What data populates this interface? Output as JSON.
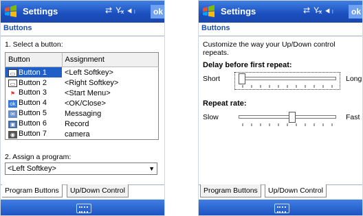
{
  "left": {
    "app_title": "Settings",
    "ok_label": "ok",
    "heading": "Buttons",
    "select_prompt": "1. Select a button:",
    "columns": [
      "Button",
      "Assignment"
    ],
    "rows": [
      {
        "button": "Button 1",
        "assignment": "<Left Softkey>",
        "icon": "softkey-left-icon"
      },
      {
        "button": "Button 2",
        "assignment": "<Right Softkey>",
        "icon": "softkey-right-icon"
      },
      {
        "button": "Button 3",
        "assignment": "<Start Menu>",
        "icon": "start-flag-icon"
      },
      {
        "button": "Button 4",
        "assignment": "<OK/Close>",
        "icon": "ok-icon"
      },
      {
        "button": "Button 5",
        "assignment": "Messaging",
        "icon": "messaging-icon"
      },
      {
        "button": "Button 6",
        "assignment": "Record",
        "icon": "record-icon"
      },
      {
        "button": "Button 7",
        "assignment": "camera",
        "icon": "camera-icon"
      }
    ],
    "selected_row": 0,
    "assign_prompt": "2. Assign a program:",
    "program_value": "<Left Softkey>",
    "tabs": [
      "Program Buttons",
      "Up/Down Control"
    ],
    "active_tab": 0
  },
  "right": {
    "app_title": "Settings",
    "ok_label": "ok",
    "heading": "Buttons",
    "description": "Customize the way your Up/Down control repeats.",
    "delay_label": "Delay before first repeat:",
    "delay_min": "Short",
    "delay_max": "Long",
    "delay_level": 0.0,
    "rate_label": "Repeat rate:",
    "rate_min": "Slow",
    "rate_max": "Fast",
    "rate_level": 0.55,
    "tabs": [
      "Program Buttons",
      "Up/Down Control"
    ],
    "active_tab": 1
  },
  "colors": {
    "titlebar": "#1b4fbf",
    "heading": "#1d4fa6",
    "selection": "#1e5fc8"
  }
}
